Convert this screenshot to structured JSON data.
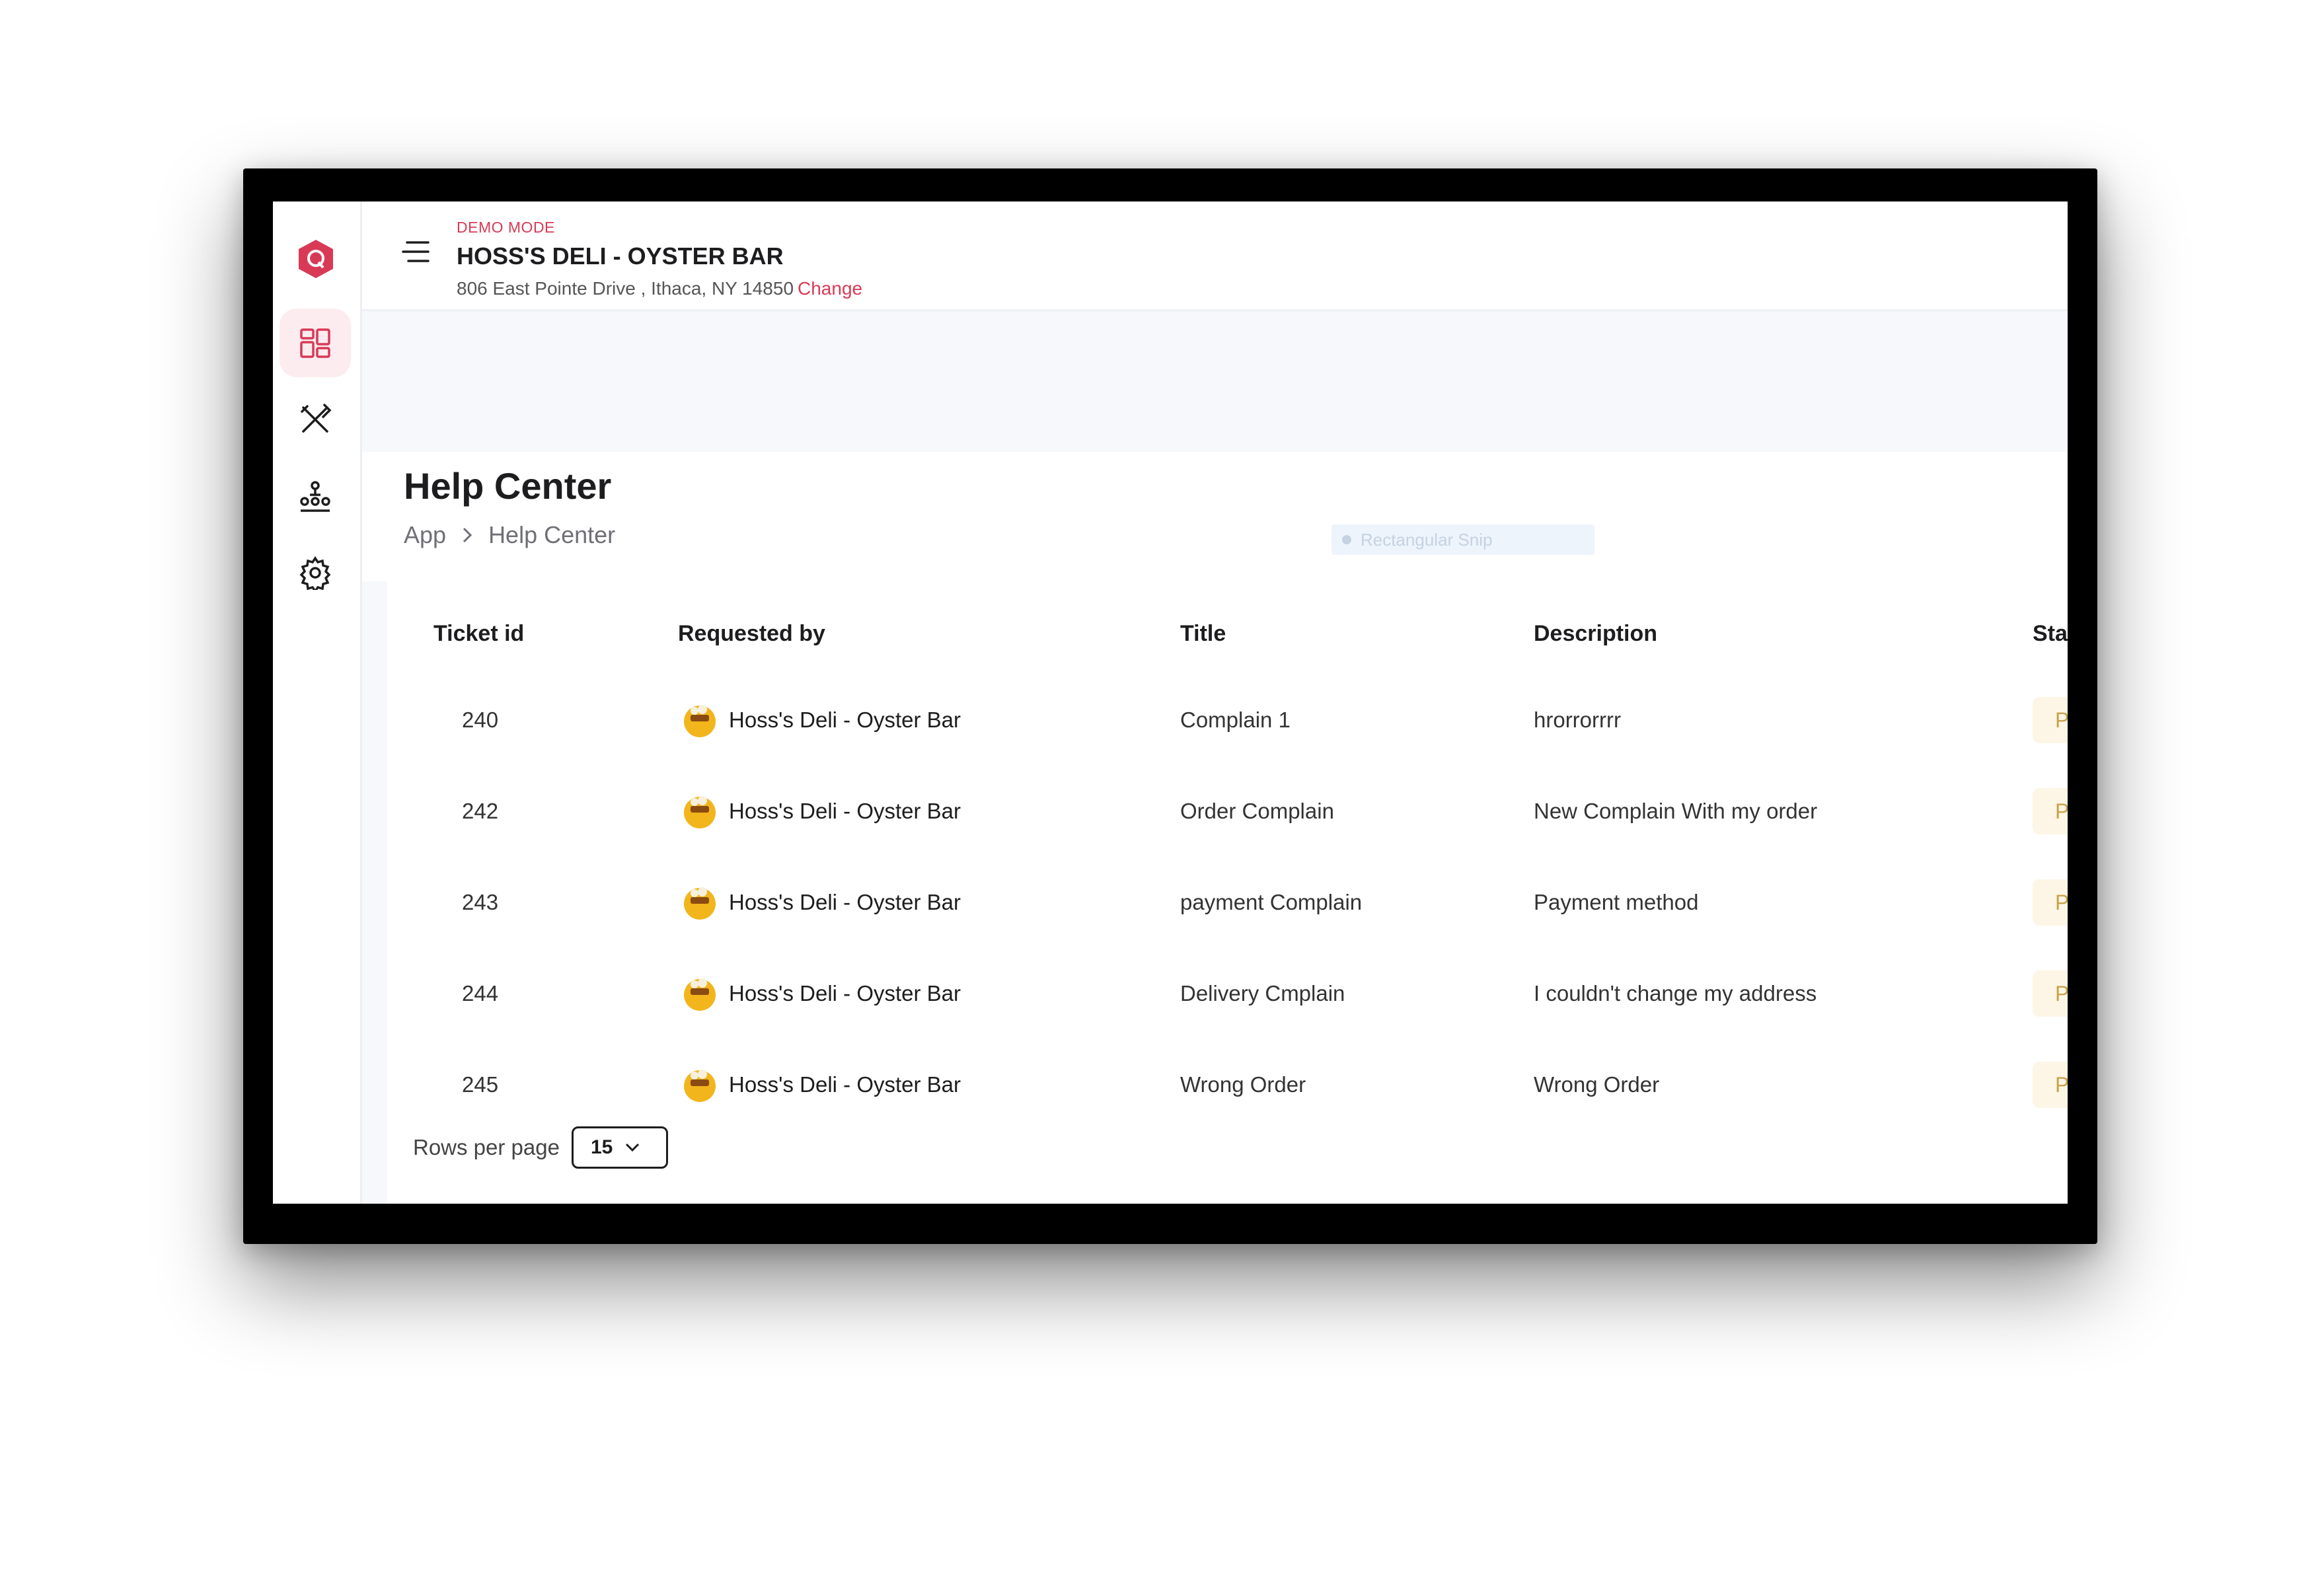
{
  "header": {
    "mode_label": "DEMO MODE",
    "store_name": "HOSS'S DELI - OYSTER BAR",
    "address": "806 East Pointe Drive , Ithaca, NY 14850",
    "change_label": "Change"
  },
  "sidebar": {
    "items": [
      {
        "icon": "dashboard-icon",
        "active": true
      },
      {
        "icon": "utensils-icon",
        "active": false
      },
      {
        "icon": "hierarchy-icon",
        "active": false
      },
      {
        "icon": "settings-gear-icon",
        "active": false
      }
    ]
  },
  "page": {
    "title": "Help Center",
    "breadcrumb": [
      "App",
      "Help Center"
    ]
  },
  "overlay": {
    "snip_label": "Rectangular Snip"
  },
  "table": {
    "columns": [
      "Ticket id",
      "Requested by",
      "Title",
      "Description",
      "Statu"
    ],
    "rows": [
      {
        "id": "240",
        "requested_by": "Hoss's Deli - Oyster Bar",
        "title": "Complain 1",
        "description": "hrorrorrrr",
        "status": "Per"
      },
      {
        "id": "242",
        "requested_by": "Hoss's Deli - Oyster Bar",
        "title": "Order Complain",
        "description": "New Complain With my order",
        "status": "Per"
      },
      {
        "id": "243",
        "requested_by": "Hoss's Deli - Oyster Bar",
        "title": "payment Complain",
        "description": "Payment method",
        "status": "Per"
      },
      {
        "id": "244",
        "requested_by": "Hoss's Deli - Oyster Bar",
        "title": "Delivery Cmplain",
        "description": "I couldn't change my address",
        "status": "Per"
      },
      {
        "id": "245",
        "requested_by": "Hoss's Deli - Oyster Bar",
        "title": "Wrong Order",
        "description": "Wrong Order",
        "status": "Per"
      }
    ]
  },
  "pagination": {
    "rows_per_page_label": "Rows per page",
    "rows_per_page_value": "15"
  },
  "colors": {
    "accent": "#d83a56",
    "pending_bg": "#fdf6e6",
    "pending_text": "#c9a24a"
  }
}
